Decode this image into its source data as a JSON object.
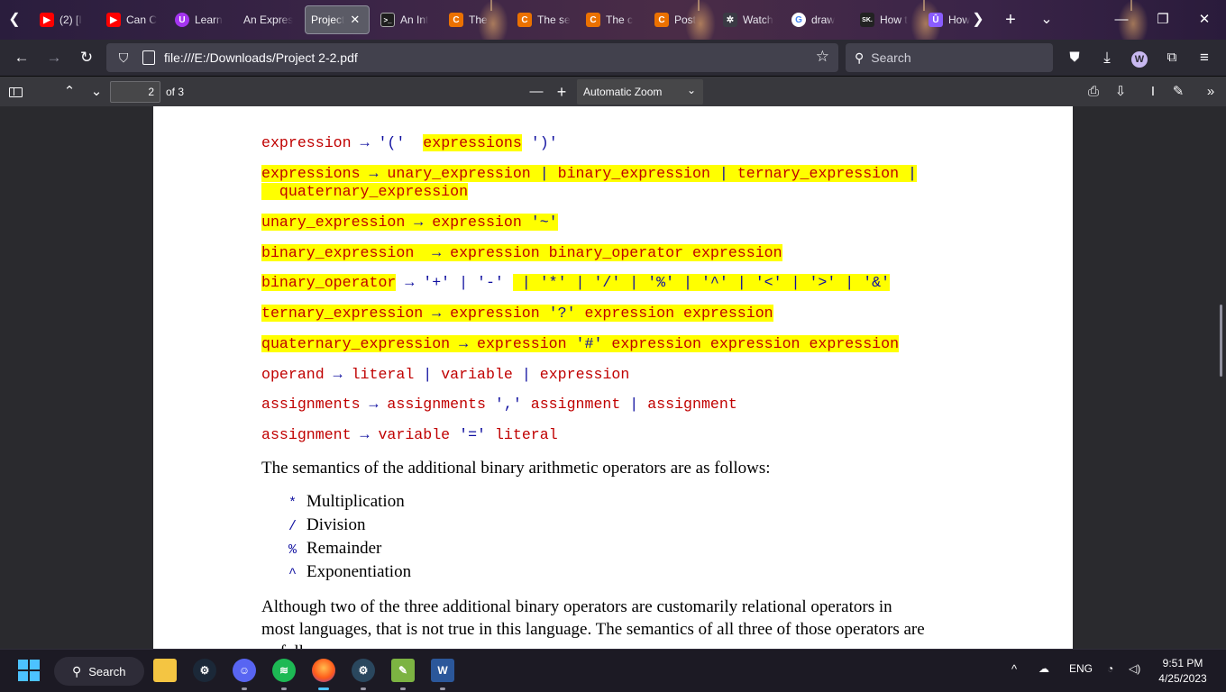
{
  "browser": {
    "tabs": [
      {
        "title": "(2) [I",
        "favicon": "youtube-icon",
        "color": "#ff0000",
        "glyph": "▶"
      },
      {
        "title": "Can C",
        "favicon": "youtube-icon",
        "color": "#ff0000",
        "glyph": "▶"
      },
      {
        "title": "Learn",
        "favicon": "udemy-icon",
        "color": "#a435f0",
        "glyph": "U"
      },
      {
        "title": "An Expres",
        "favicon": "",
        "color": "",
        "glyph": ""
      },
      {
        "title": "Project",
        "favicon": "",
        "color": "",
        "glyph": "",
        "active": true
      },
      {
        "title": "An Int",
        "favicon": "terminal-icon",
        "color": "#1e1e1e",
        "glyph": ">_"
      },
      {
        "title": "The",
        "favicon": "chegg-icon",
        "color": "#eb7100",
        "glyph": "C"
      },
      {
        "title": "The se",
        "favicon": "chegg-icon",
        "color": "#eb7100",
        "glyph": "C"
      },
      {
        "title": "The c",
        "favicon": "chegg-icon",
        "color": "#eb7100",
        "glyph": "C"
      },
      {
        "title": "Post",
        "favicon": "chegg-icon",
        "color": "#eb7100",
        "glyph": "C"
      },
      {
        "title": "Watch",
        "favicon": "puzzle-icon",
        "color": "#3a3a44",
        "glyph": "✲"
      },
      {
        "title": "draw",
        "favicon": "google-icon",
        "color": "#ffffff",
        "glyph": "G"
      },
      {
        "title": "How t",
        "favicon": "sk-icon",
        "color": "#222222",
        "glyph": "SK."
      },
      {
        "title": "How",
        "favicon": "shield-u-icon",
        "color": "#8a5cff",
        "glyph": "Û"
      }
    ],
    "url": "file:///E:/Downloads/Project 2-2.pdf",
    "search_placeholder": "Search",
    "profile_initial": "W"
  },
  "pdf_toolbar": {
    "page_number": "2",
    "page_count": "of 3",
    "zoom": "Automatic Zoom"
  },
  "document": {
    "grammar_lines": [
      "expression → '(' expressions ')'",
      "expressions → unary_expression | binary_expression | ternary_expression | quaternary_expression",
      "unary_expression → expression '~'",
      "binary_expression → expression binary_operator expression",
      "binary_operator → '+' | '-' | '*' | '/' | '%' | '^' | '<' | '>' | '&'",
      "ternary_expression → expression '?' expression expression",
      "quaternary_expression → expression '#' expression expression expression",
      "operand → literal | variable | expression",
      "assignments → assignments ',' assignment | assignment",
      "assignment → variable '=' literal"
    ],
    "intro": "The semantics of the additional binary arithmetic operators are as follows:",
    "operators": [
      {
        "symbol": "*",
        "meaning": "Multiplication"
      },
      {
        "symbol": "/",
        "meaning": "Division"
      },
      {
        "symbol": "%",
        "meaning": "Remainder"
      },
      {
        "symbol": "^",
        "meaning": "Exponentiation"
      }
    ],
    "paragraph_line1": "Although two of the three additional binary operators are customarily relational operators in",
    "paragraph_line2": "most languages, that is not true in this language. The semantics of all three of those operators are",
    "paragraph_line3": "as follows:"
  },
  "taskbar": {
    "search_label": "Search",
    "language": "ENG",
    "time": "9:51 PM",
    "date": "4/25/2023",
    "pinned": [
      "windows-start-icon",
      "file-explorer-icon",
      "steam-icon",
      "discord-icon",
      "spotify-icon",
      "firefox-icon",
      "steam-icon",
      "notepad-icon",
      "word-icon"
    ]
  }
}
